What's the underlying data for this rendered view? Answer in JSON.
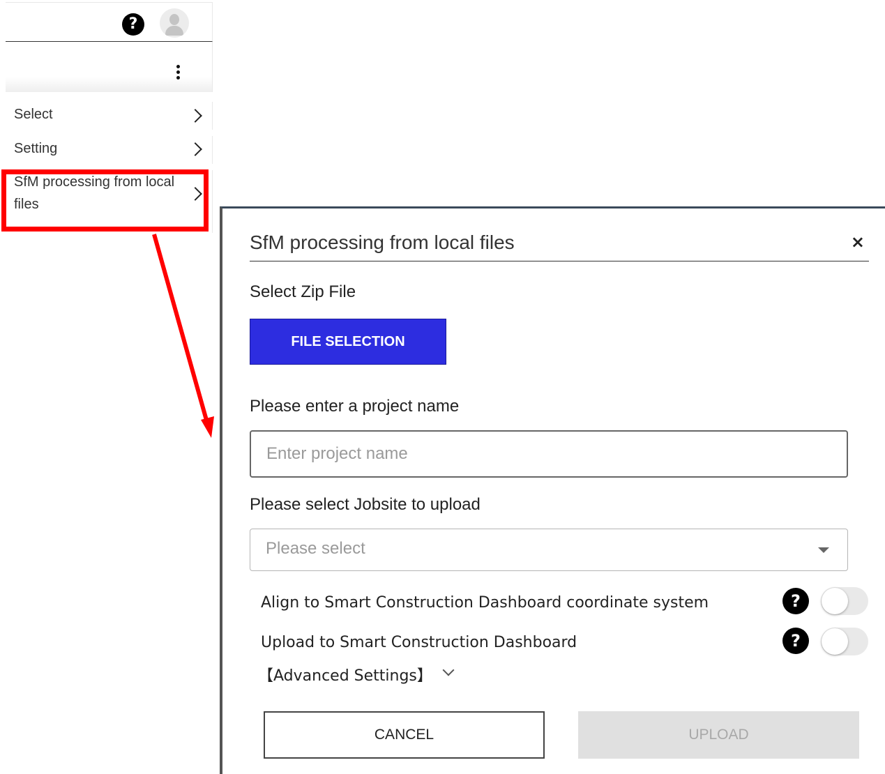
{
  "header": {
    "help_glyph": "?"
  },
  "menu": {
    "items": [
      {
        "label": "Select"
      },
      {
        "label": "Setting"
      },
      {
        "label": "SfM processing from local files"
      }
    ]
  },
  "dialog": {
    "title": "SfM processing from local files",
    "close_glyph": "×",
    "zip_label": "Select Zip File",
    "file_button": "FILE SELECTION",
    "project_label": "Please enter a project name",
    "project_placeholder": "Enter project name",
    "project_value": "",
    "jobsite_label": "Please select Jobsite to upload",
    "jobsite_placeholder": "Please select",
    "options": [
      {
        "label": "Align to Smart Construction Dashboard coordinate system",
        "enabled": false
      },
      {
        "label": "Upload to Smart Construction Dashboard",
        "enabled": false
      }
    ],
    "help_glyph": "?",
    "advanced_label": "【Advanced Settings】",
    "cancel_label": "CANCEL",
    "upload_label": "UPLOAD"
  },
  "colors": {
    "primary_button": "#2d2de0",
    "highlight": "#ff0000",
    "disabled_button": "#e0e0e0"
  }
}
